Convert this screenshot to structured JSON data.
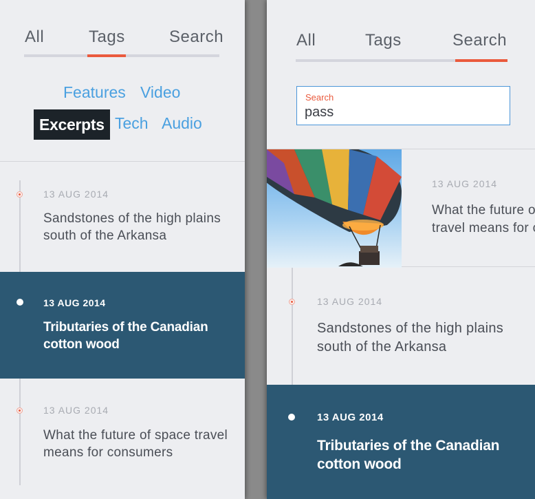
{
  "tabs": [
    "All",
    "Tags",
    "Search"
  ],
  "tag_cloud": {
    "features": "Features",
    "video": "Video",
    "excerpts": "Excerpts",
    "tech": "Tech",
    "audio": "Audio"
  },
  "left_entries": [
    {
      "date": "13 AUG 2014",
      "title": "Sandstones of the high plains south of the Arkansa"
    },
    {
      "date": "13 AUG 2014",
      "title": "Tributaries of the Canadian cotton wood"
    },
    {
      "date": "13 AUG 2014",
      "title": "What the future of space travel means for consumers"
    }
  ],
  "search": {
    "label": "Search",
    "value": "pass"
  },
  "result": {
    "date": "13 AUG 2014",
    "title": "What the future of space\ntravel means for consumers",
    "image": "hot-air-balloon"
  },
  "right_entries": [
    {
      "date": "13 AUG 2014",
      "title": "Sandstones of the high plains south of the Arkansa"
    },
    {
      "date": "13 AUG 2014",
      "title": "Tributaries of the Canadian cotton wood"
    }
  ],
  "colors": {
    "accent": "#ea5a3d",
    "link": "#4aa0e0",
    "highlight_bg": "#2c5873",
    "active_tag_bg": "#1c2329"
  }
}
